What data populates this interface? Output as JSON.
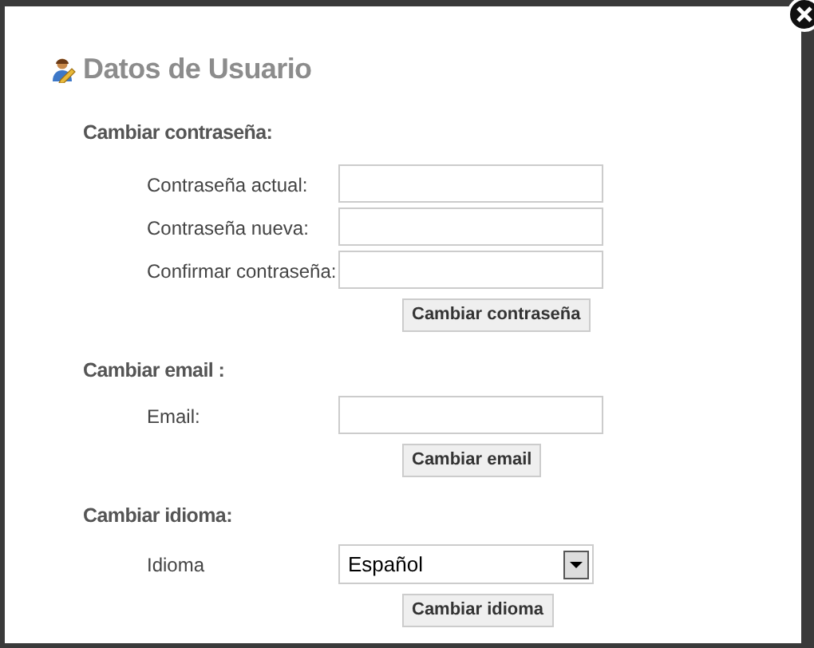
{
  "dialog": {
    "title": "Datos de Usuario"
  },
  "sections": [
    {
      "heading": "Cambiar contraseña:",
      "fields": [
        {
          "kind": "input",
          "label": "Contraseña actual:"
        },
        {
          "kind": "input",
          "label": "Contraseña nueva:"
        },
        {
          "kind": "input",
          "label": "Confirmar contraseña:"
        }
      ],
      "button": "Cambiar contraseña"
    },
    {
      "heading": "Cambiar email :",
      "fields": [
        {
          "kind": "input",
          "label": "Email:"
        }
      ],
      "button": "Cambiar email"
    },
    {
      "heading": "Cambiar idioma:",
      "fields": [
        {
          "kind": "select",
          "label": "Idioma",
          "value": "Español"
        }
      ],
      "button": "Cambiar idioma"
    }
  ]
}
